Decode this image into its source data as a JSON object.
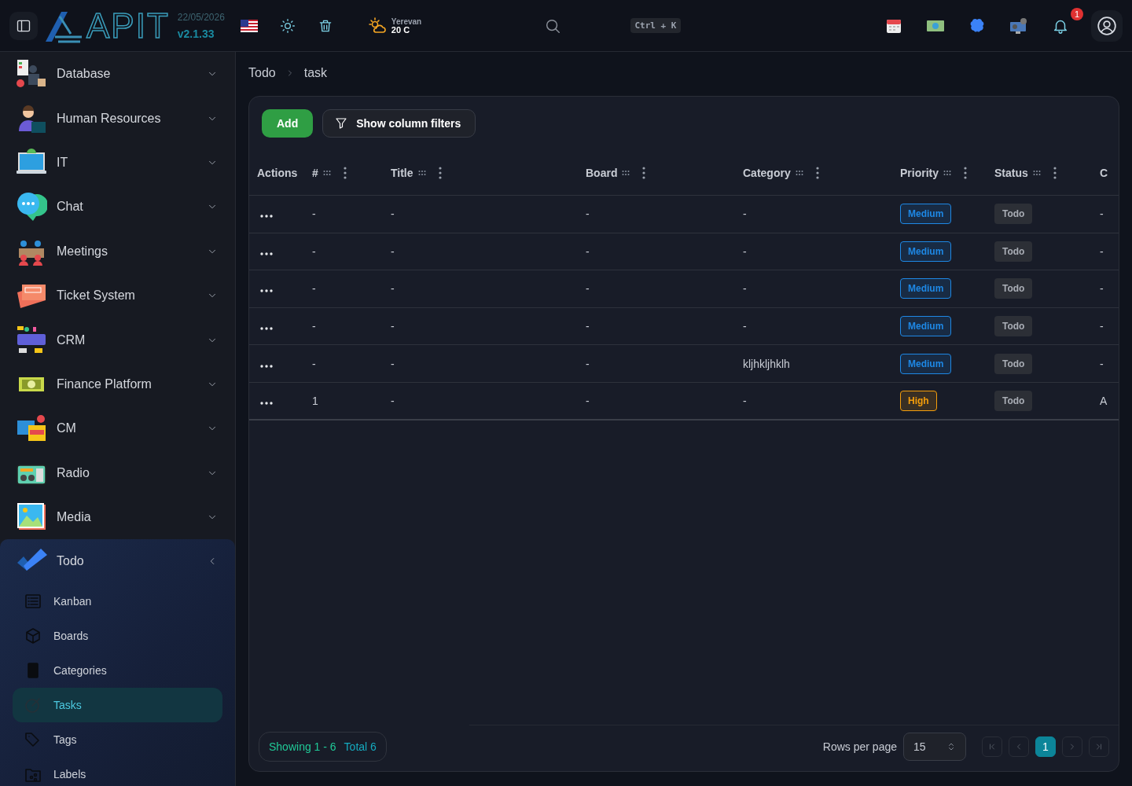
{
  "header": {
    "logo": "APIT",
    "date": "22/05/2026",
    "version": "v2.1.33",
    "weather": {
      "city": "Yerevan",
      "temp": "20 C"
    },
    "shortcut": "Ctrl + K",
    "notifications": "1"
  },
  "sidebar": {
    "items": [
      {
        "label": "Database",
        "expanded": false
      },
      {
        "label": "Human Resources",
        "expanded": false
      },
      {
        "label": "IT",
        "expanded": false
      },
      {
        "label": "Chat",
        "expanded": false
      },
      {
        "label": "Meetings",
        "expanded": false
      },
      {
        "label": "Ticket System",
        "expanded": false
      },
      {
        "label": "CRM",
        "expanded": false
      },
      {
        "label": "Finance Platform",
        "expanded": false
      },
      {
        "label": "CM",
        "expanded": false
      },
      {
        "label": "Radio",
        "expanded": false
      },
      {
        "label": "Media",
        "expanded": false
      },
      {
        "label": "Todo",
        "expanded": true,
        "children": [
          {
            "label": "Kanban",
            "selected": false
          },
          {
            "label": "Boards",
            "selected": false
          },
          {
            "label": "Categories",
            "selected": false
          },
          {
            "label": "Tasks",
            "selected": true
          },
          {
            "label": "Tags",
            "selected": false
          },
          {
            "label": "Labels",
            "selected": false
          }
        ]
      }
    ]
  },
  "breadcrumb": [
    "Todo",
    "task"
  ],
  "toolbar": {
    "add": "Add",
    "filters": "Show column filters"
  },
  "table": {
    "columns": [
      "Actions",
      "#",
      "Title",
      "Board",
      "Category",
      "Priority",
      "Status",
      "C"
    ],
    "rows": [
      {
        "number": "-",
        "title": "-",
        "board": "-",
        "category": "-",
        "priority": {
          "label": "Medium",
          "color": "#1e88e5"
        },
        "status": "Todo",
        "column_8": "-"
      },
      {
        "number": "-",
        "title": "-",
        "board": "-",
        "category": "-",
        "priority": {
          "label": "Medium",
          "color": "#1e88e5"
        },
        "status": "Todo",
        "column_8": "-"
      },
      {
        "number": "-",
        "title": "-",
        "board": "-",
        "category": "-",
        "priority": {
          "label": "Medium",
          "color": "#1e88e5"
        },
        "status": "Todo",
        "column_8": "-"
      },
      {
        "number": "-",
        "title": "-",
        "board": "-",
        "category": "-",
        "priority": {
          "label": "Medium",
          "color": "#1e88e5"
        },
        "status": "Todo",
        "column_8": "-"
      },
      {
        "number": "-",
        "title": "-",
        "board": "-",
        "category": "kljhkljhklh",
        "priority": {
          "label": "Medium",
          "color": "#1e88e5"
        },
        "status": "Todo",
        "column_8": "-"
      },
      {
        "number": "1",
        "title": "-",
        "board": "-",
        "category": "-",
        "priority": {
          "label": "High",
          "color": "#f59e0b"
        },
        "status": "Todo",
        "column_8": "A"
      }
    ]
  },
  "footer": {
    "showing": "Showing 1 - 6",
    "total": "Total 6",
    "rows_per_page_label": "Rows per page",
    "rows_per_page": "15",
    "pages": [
      {
        "label": "1",
        "selected": true
      }
    ]
  }
}
